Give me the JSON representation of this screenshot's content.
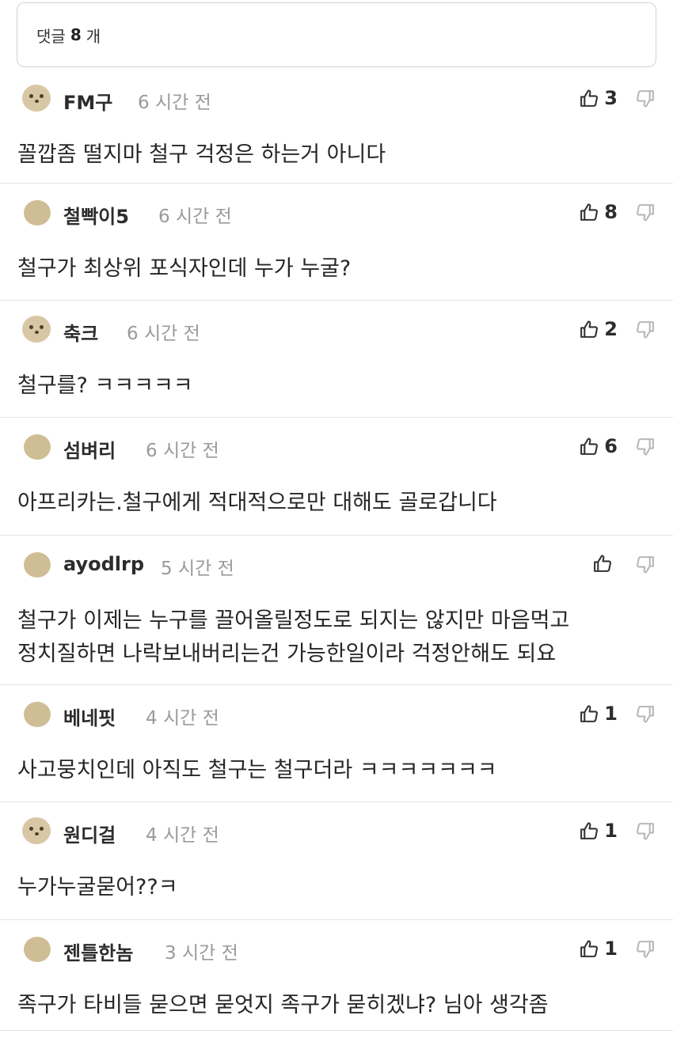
{
  "header": {
    "prefix": "댓글",
    "count": "8",
    "suffix": "개"
  },
  "comments": [
    {
      "user": "FM구",
      "time": "6 시간 전",
      "likes": "3",
      "text": [
        "꼴깝좀 떨지마 철구 걱정은 하는거 아니다"
      ],
      "avatar": "dog-avatar"
    },
    {
      "user": "철빡이5",
      "time": "6 시간 전",
      "likes": "8",
      "text": [
        "철구가 최상위 포식자인데 누가 누굴?"
      ],
      "avatar": "default-avatar"
    },
    {
      "user": "축크",
      "time": "6 시간 전",
      "likes": "2",
      "text": [
        "철구를? ㅋㅋㅋㅋㅋ"
      ],
      "avatar": "dog-avatar"
    },
    {
      "user": "섬벼리",
      "time": "6 시간 전",
      "likes": "6",
      "text": [
        "아프리카는.철구에게 적대적으로만 대해도 골로갑니다"
      ],
      "avatar": "default-avatar"
    },
    {
      "user": "ayodlrp",
      "time": "5 시간 전",
      "likes": "",
      "text": [
        "철구가 이제는 누구를 끌어올릴정도로 되지는 않지만 마음먹고",
        "정치질하면 나락보내버리는건 가능한일이라 걱정안해도 되요"
      ],
      "avatar": "default-avatar"
    },
    {
      "user": "베네핏",
      "time": "4 시간 전",
      "likes": "1",
      "text": [
        "사고뭉치인데 아직도 철구는 철구더라 ㅋㅋㅋㅋㅋㅋㅋ"
      ],
      "avatar": "default-avatar"
    },
    {
      "user": "원디걸",
      "time": "4 시간 전",
      "likes": "1",
      "text": [
        "누가누굴묻어??ㅋ"
      ],
      "avatar": "dog-avatar"
    },
    {
      "user": "젠틀한놈",
      "time": "3 시간 전",
      "likes": "1",
      "text": [
        "족구가 타비들 묻으면 묻엇지 족구가 묻히겠냐? 님아 생각좀"
      ],
      "avatar": "default-avatar"
    }
  ],
  "icons": {
    "like": "thumbs-up-icon",
    "dislike": "thumbs-down-icon"
  },
  "colors": {
    "avatar": "#d8c7a4",
    "muted": "#9a9a9a",
    "divider": "#e4e4e4"
  }
}
